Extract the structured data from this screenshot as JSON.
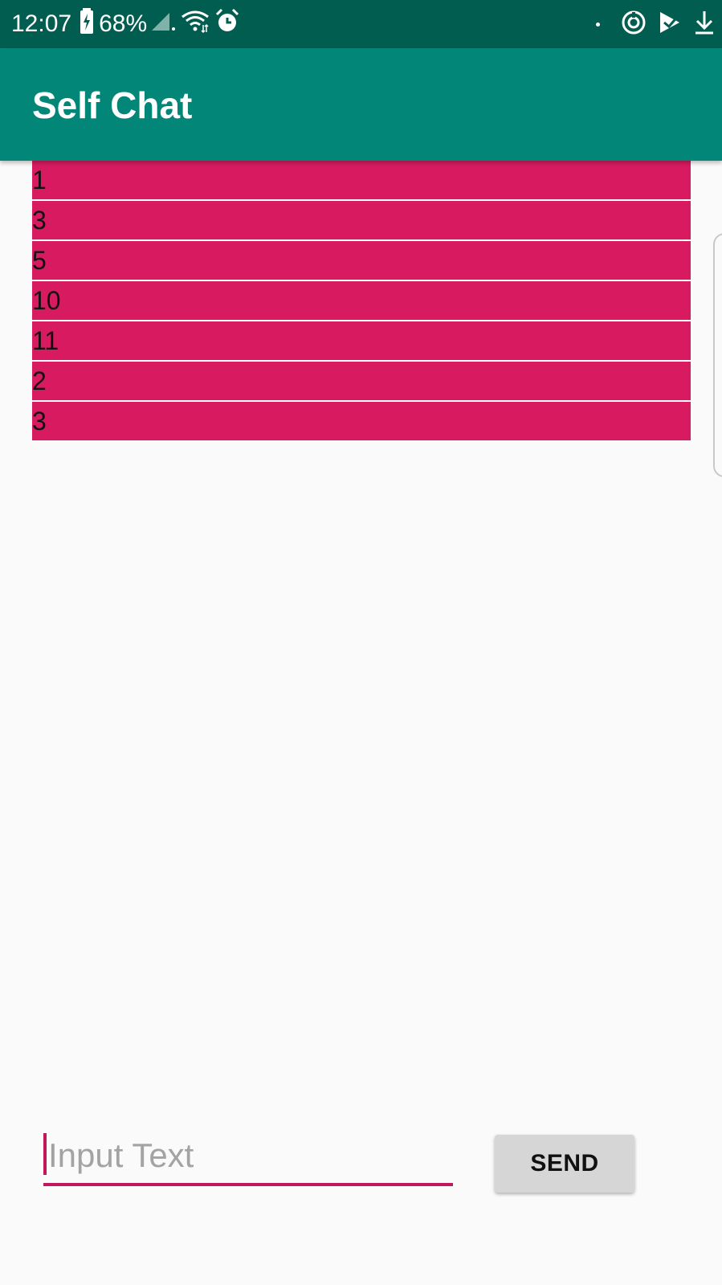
{
  "status_bar": {
    "time": "12:07",
    "battery": "68%",
    "left_icons": [
      "battery-charging-icon",
      "signal-icon",
      "wifi-icon",
      "alarm-icon"
    ],
    "right_icons": [
      "notification-dot-icon",
      "sync-icon",
      "play-store-icon",
      "download-icon"
    ]
  },
  "app_bar": {
    "title": "Self Chat"
  },
  "messages": [
    "1",
    "3",
    "5",
    "10",
    "11",
    "2",
    "3"
  ],
  "composer": {
    "placeholder": "Input Text",
    "value": "",
    "send_label": "SEND"
  },
  "colors": {
    "status_bar": "#025d51",
    "app_bar": "#028677",
    "message_bg": "#d81b60",
    "accent": "#c2185b",
    "background": "#fafafa",
    "button_bg": "#d6d6d6"
  }
}
